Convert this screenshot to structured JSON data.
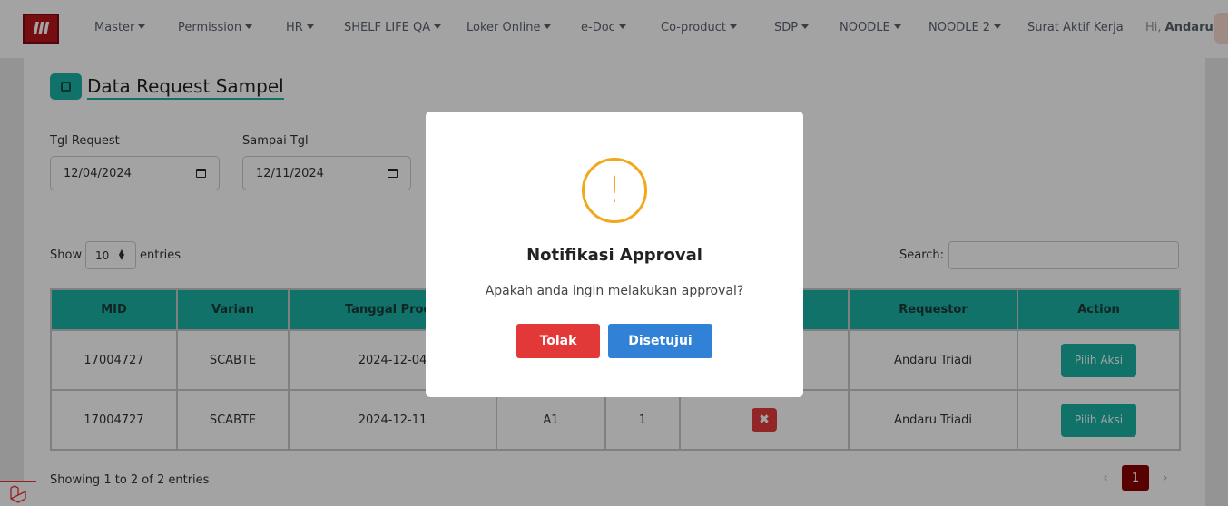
{
  "navbar": {
    "logo_text": "III",
    "menu": [
      {
        "label": "Master"
      },
      {
        "label": "Permission"
      },
      {
        "label": "HR"
      },
      {
        "label": "SHELF LIFE QA"
      },
      {
        "label": "Loker Online"
      },
      {
        "label": "e-Doc"
      },
      {
        "label": "Co-product"
      },
      {
        "label": "SDP"
      },
      {
        "label": "NOODLE"
      },
      {
        "label": "NOODLE 2"
      },
      {
        "label": "Surat Aktif Kerja"
      }
    ],
    "greeting": "Hi,",
    "user_name": "Andaru"
  },
  "page": {
    "title": "Data Request Sampel",
    "filters": {
      "tgl_request_label": "Tgl Request",
      "tgl_request_value": "12/04/2024",
      "sampai_tgl_label": "Sampai Tgl",
      "sampai_tgl_value": "12/11/2024"
    },
    "table_controls": {
      "show_label": "Show",
      "entries_value": "10",
      "entries_label": "entries",
      "search_label": "Search:"
    },
    "table": {
      "headers": [
        "MID",
        "Varian",
        "Tanggal Produ",
        "",
        "",
        "",
        "Requestor",
        "Action"
      ],
      "rows": [
        {
          "mid": "17004727",
          "varian": "SCABTE",
          "tanggal": "2024-12-04",
          "col4": "",
          "col5": "",
          "requestor": "Andaru Triadi",
          "action": "Pilih Aksi"
        },
        {
          "mid": "17004727",
          "varian": "SCABTE",
          "tanggal": "2024-12-11",
          "col4": "A1",
          "col5": "1",
          "requestor": "Andaru Triadi",
          "action": "Pilih Aksi"
        }
      ]
    },
    "info": "Showing 1 to 2 of 2 entries",
    "pagination": {
      "prev": "‹",
      "current": "1",
      "next": "›"
    }
  },
  "modal": {
    "icon": "!",
    "title": "Notifikasi Approval",
    "message": "Apakah anda ingin melakukan approval?",
    "reject_label": "Tolak",
    "approve_label": "Disetujui"
  },
  "colors": {
    "accent": "#1cb3a5",
    "reject": "#e33838",
    "approve": "#3182d6",
    "warning": "#f1a81a",
    "brand": "#b8151b"
  }
}
